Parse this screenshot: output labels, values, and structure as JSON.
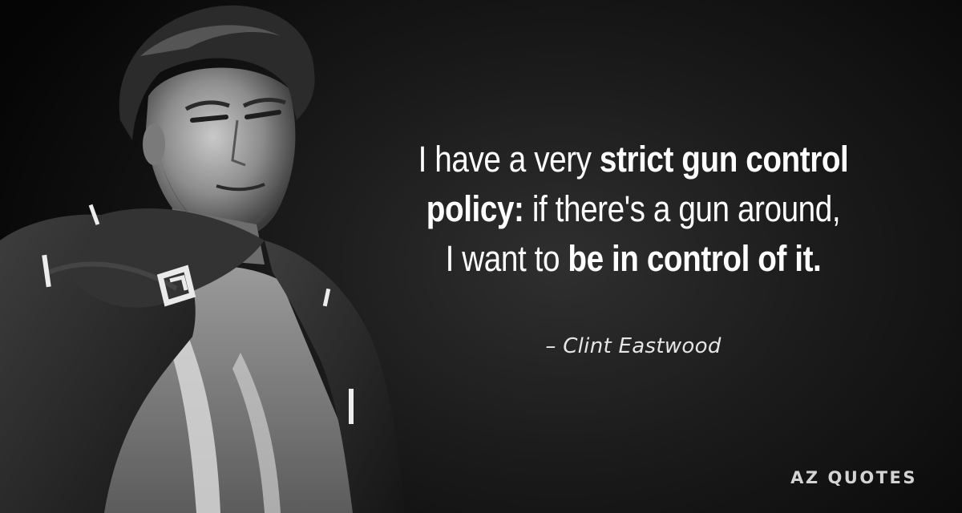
{
  "quote": {
    "lines": [
      [
        {
          "text": "I have a very ",
          "bold": false
        },
        {
          "text": "strict gun control",
          "bold": true
        }
      ],
      [
        {
          "text": "policy:",
          "bold": true
        },
        {
          "text": " if there's a gun around,",
          "bold": false
        }
      ],
      [
        {
          "text": "I want to ",
          "bold": false
        },
        {
          "text": "be in control of it.",
          "bold": true
        }
      ]
    ]
  },
  "author": "– Clint Eastwood",
  "brand": "AZ QUOTES",
  "colors": {
    "background": "#1c1c1c",
    "text": "#ffffff",
    "author_text": "#e6e6e6",
    "brand_text": "#d4d4d4"
  }
}
